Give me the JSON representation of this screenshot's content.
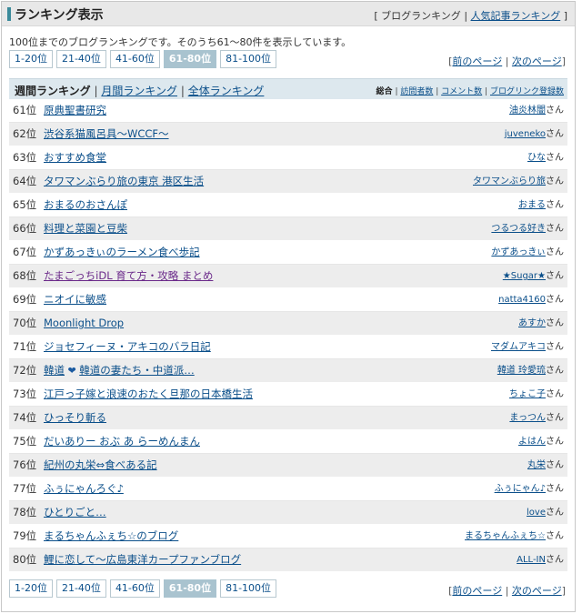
{
  "header": {
    "title": "ランキング表示",
    "blog_ranking_link": "ブログランキング",
    "popular_link": "人気記事ランキング",
    "open_bracket": "[",
    "close_bracket": "]",
    "sep": "|"
  },
  "description": "100位までのブログランキングです。そのうち61～80件を表示しています。",
  "pager": {
    "pages": [
      "1-20位",
      "21-40位",
      "41-60位",
      "61-80位",
      "81-100位"
    ],
    "active_index": 3,
    "prev": "前のページ",
    "next": "次のページ"
  },
  "tabs": {
    "weekly": "週間ランキング",
    "monthly": "月間ランキング",
    "overall": "全体ランキング"
  },
  "sorts": {
    "total": "総合",
    "visitors": "訪問者数",
    "comments": "コメント数",
    "backlinks": "ブログリンク登録数"
  },
  "rank_suffix": "位",
  "san_suffix": "さん",
  "rows": [
    {
      "rank": "61",
      "blog": "原典聖書研究",
      "author": "油炎林闇"
    },
    {
      "rank": "62",
      "blog": "渋谷系猫風呂具～WCCF～",
      "author": "juveneko"
    },
    {
      "rank": "63",
      "blog": "おすすめ食堂",
      "author": "ひな"
    },
    {
      "rank": "64",
      "blog": "タワマンぶらり旅の東京 港区生活",
      "author": "タワマンぶらり旅"
    },
    {
      "rank": "65",
      "blog": "おまるのおさんぽ",
      "author": "おまる"
    },
    {
      "rank": "66",
      "blog": "料理と菜園と豆柴",
      "author": "つるつる好き"
    },
    {
      "rank": "67",
      "blog": "かずあっきぃのラーメン食べ歩記",
      "author": "かずあっきぃ"
    },
    {
      "rank": "68",
      "blog": "たまごっちiDL 育て方・攻略 まとめ",
      "author": "★Sugar★",
      "visited": true
    },
    {
      "rank": "69",
      "blog": "ニオイに敏感",
      "author": "natta4160"
    },
    {
      "rank": "70",
      "blog": "Moonlight Drop",
      "author": "あすか"
    },
    {
      "rank": "71",
      "blog": "ジョセフィーヌ・アキコのバラ日記",
      "author": "マダムアキコ"
    },
    {
      "rank": "72",
      "blog_a": "韓道",
      "blog_b": "韓道の妻たち・中道派…",
      "author": "韓道 玲愛琉",
      "heart": true
    },
    {
      "rank": "73",
      "blog": "江戸っ子嫁と浪速のおたく旦那の日本橋生活",
      "author": "ちょこ子"
    },
    {
      "rank": "74",
      "blog": "ひっそり斬る",
      "author": "まっつん"
    },
    {
      "rank": "75",
      "blog": "だいありー おぶ あ らーめんまん",
      "author": "よはん"
    },
    {
      "rank": "76",
      "blog": "紀州の丸栄⇔食べある記",
      "author": "丸栄"
    },
    {
      "rank": "77",
      "blog": "ふぅにゃんろぐ♪",
      "author": "ふぅにゃん♪"
    },
    {
      "rank": "78",
      "blog": "ひとりごと…",
      "author": "love"
    },
    {
      "rank": "79",
      "blog": "まるちゃんふぇち☆のブログ",
      "author": "まるちゃんふぇち☆"
    },
    {
      "rank": "80",
      "blog": "鯉に恋して～広島東洋カープファンブログ",
      "author": "ALL-IN"
    }
  ],
  "colors": {
    "accent": "#3a8a9a",
    "link": "#0b4f8a",
    "active_page": "#a9c3cf",
    "tab_bar": "#dde8ee"
  },
  "icons": {
    "heart": "heart-icon"
  }
}
